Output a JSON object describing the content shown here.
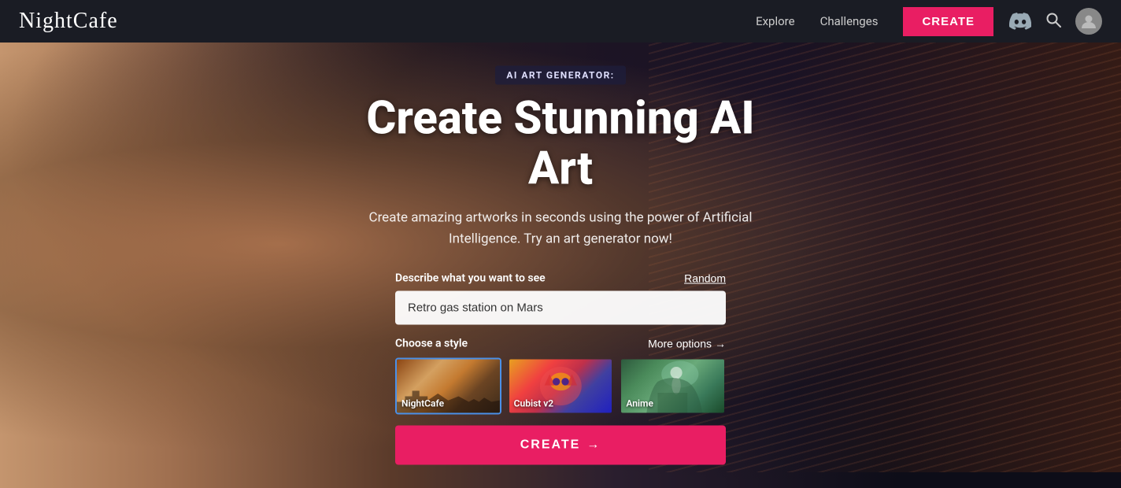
{
  "navbar": {
    "logo": "NightCafe",
    "explore_label": "Explore",
    "challenges_label": "Challenges",
    "create_label": "CREATE"
  },
  "hero": {
    "badge": "AI ART GENERATOR:",
    "title": "Create Stunning AI Art",
    "subtitle": "Create amazing artworks in seconds using the power of Artificial Intelligence. Try an art generator now!",
    "prompt_label": "Describe what you want to see",
    "random_label": "Random",
    "prompt_value": "Retro gas station on Mars",
    "style_label": "Choose a style",
    "more_options_label": "More options",
    "more_options_arrow": "→",
    "styles": [
      {
        "id": "nightcafe",
        "label": "NightCafe",
        "selected": true
      },
      {
        "id": "cubist",
        "label": "Cubist v2",
        "selected": false
      },
      {
        "id": "anime",
        "label": "Anime",
        "selected": false
      }
    ],
    "create_btn_label": "CREATE",
    "create_btn_arrow": "→"
  }
}
